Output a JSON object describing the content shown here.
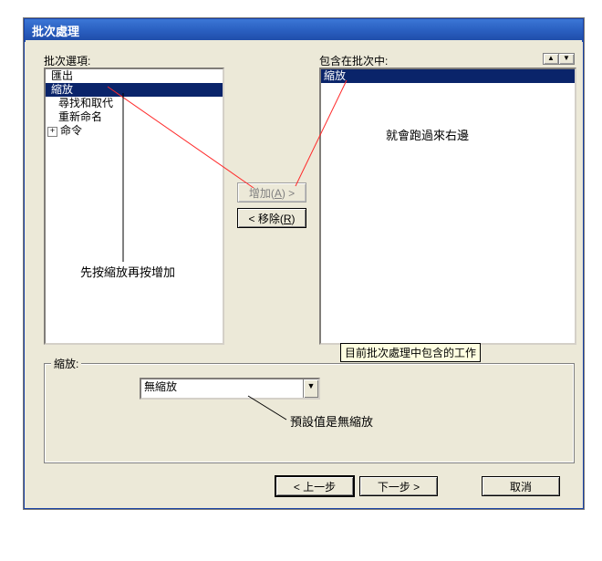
{
  "window": {
    "title": "批次處理"
  },
  "labels": {
    "options": "批次選項:",
    "included": "包含在批次中:"
  },
  "left_list": {
    "items": {
      "0": "匯出",
      "1": "縮放",
      "2": "尋找和取代",
      "3": "重新命名",
      "4": "命令"
    }
  },
  "right_list": {
    "items": {
      "0": "縮放"
    }
  },
  "buttons": {
    "add": "增加(A) >",
    "add_key": "A",
    "remove": "< 移除(R)",
    "remove_key": "R",
    "back": "< 上一步",
    "next": "下一步 >",
    "cancel": "取消"
  },
  "tooltip": "目前批次處理中包含的工作",
  "group": {
    "caption": "縮放:"
  },
  "combo": {
    "value": "無縮放"
  },
  "annotations": {
    "right_note": "就會跑過來右邊",
    "left_note": "先按縮放再按增加",
    "combo_note": "預設值是無縮放"
  }
}
